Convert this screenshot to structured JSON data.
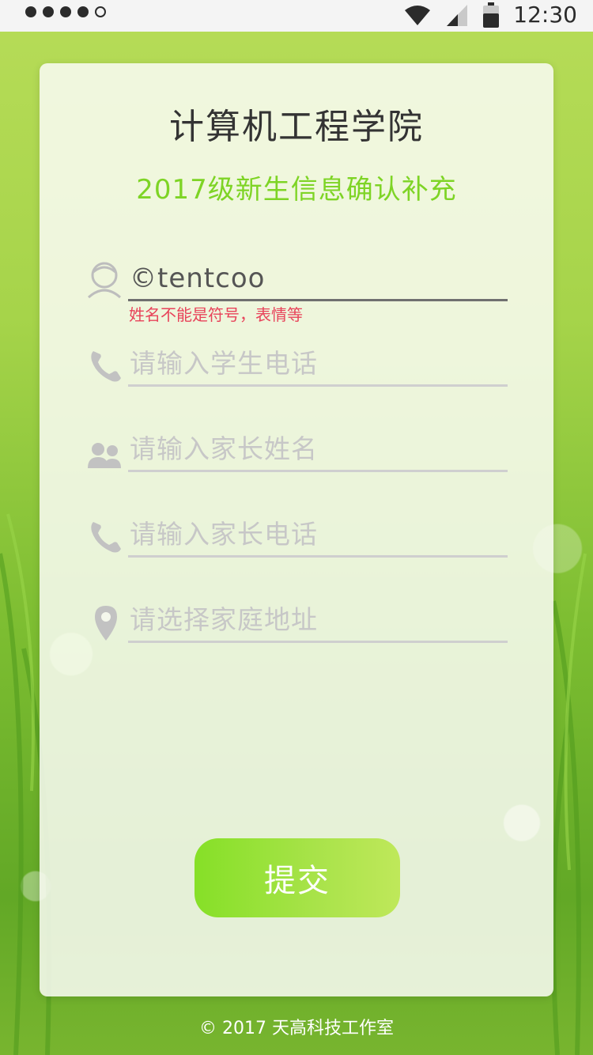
{
  "status_bar": {
    "time": "12:30",
    "wifi_icon": "wifi-icon",
    "cell_icon": "cellular-signal-icon",
    "battery_icon": "battery-icon"
  },
  "header": {
    "title": "计算机工程学院",
    "subtitle": "2017级新生信息确认补充"
  },
  "form": {
    "student_name": {
      "icon": "person-icon",
      "value": "©tentcoo",
      "error": "姓名不能是符号，表情等"
    },
    "student_phone": {
      "icon": "phone-icon",
      "placeholder": "请输入学生电话"
    },
    "parent_name": {
      "icon": "parents-icon",
      "placeholder": "请输入家长姓名"
    },
    "parent_phone": {
      "icon": "phone-icon",
      "placeholder": "请输入家长电话"
    },
    "home_address": {
      "icon": "location-pin-icon",
      "placeholder": "请选择家庭地址"
    },
    "submit_label": "提交"
  },
  "footer": {
    "text": "© 2017 天高科技工作室"
  },
  "colors": {
    "accent": "#7ed425",
    "error": "#e8435a",
    "button_start": "#86e027",
    "button_end": "#bfe85a"
  }
}
